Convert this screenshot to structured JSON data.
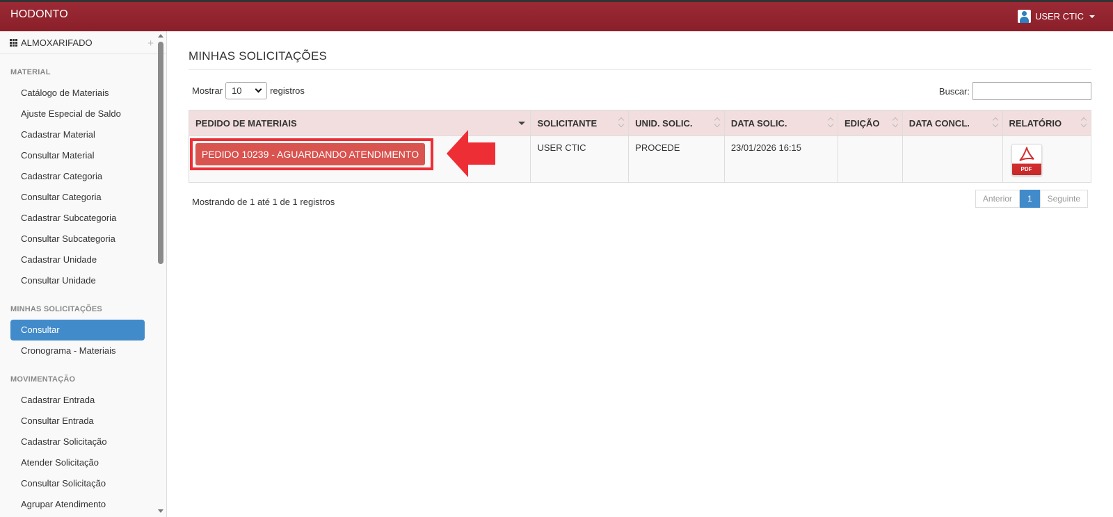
{
  "header": {
    "brand": "HODONTO",
    "user": "USER CTIC"
  },
  "sidebar": {
    "title": "ALMOXARIFADO",
    "sections": [
      {
        "title": "MATERIAL",
        "items": [
          "Catálogo de Materiais",
          "Ajuste Especial de Saldo",
          "Cadastrar Material",
          "Consultar Material",
          "Cadastrar Categoria",
          "Consultar Categoria",
          "Cadastrar Subcategoria",
          "Consultar Subcategoria",
          "Cadastrar Unidade",
          "Consultar Unidade"
        ]
      },
      {
        "title": "MINHAS SOLICITAÇÕES",
        "items": [
          "Consultar",
          "Cronograma - Materiais"
        ]
      },
      {
        "title": "MOVIMENTAÇÃO",
        "items": [
          "Cadastrar Entrada",
          "Consultar Entrada",
          "Cadastrar Solicitação",
          "Atender Solicitação",
          "Consultar Solicitação",
          "Agrupar Atendimento"
        ]
      }
    ],
    "active_item": "Consultar"
  },
  "main": {
    "title": "MINHAS SOLICITAÇÕES",
    "show_label": "Mostrar",
    "page_size": "10",
    "records_label": "registros",
    "search_label": "Buscar:",
    "search_value": ""
  },
  "table": {
    "columns": [
      "PEDIDO DE MATERIAIS",
      "SOLICITANTE",
      "UNID. SOLIC.",
      "DATA SOLIC.",
      "EDIÇÃO",
      "DATA CONCL.",
      "RELATÓRIO"
    ],
    "rows": [
      {
        "pedido": "PEDIDO 10239 - AGUARDANDO ATENDIMENTO",
        "solicitante": "USER CTIC",
        "unidade": "PROCEDE",
        "data": "23/01/2026 16:15",
        "edicao": "",
        "data_concl": "",
        "relatorio": "PDF"
      }
    ]
  },
  "pagination": {
    "info": "Mostrando de 1 até 1 de 1 registros",
    "previous": "Anterior",
    "current": "1",
    "next": "Seguinte"
  },
  "colors": {
    "topbar": "#8a1f29",
    "header_row": "#f2dede",
    "request_button": "#d9534f",
    "highlight": "#ee2e35",
    "active_menu": "#428bca"
  }
}
